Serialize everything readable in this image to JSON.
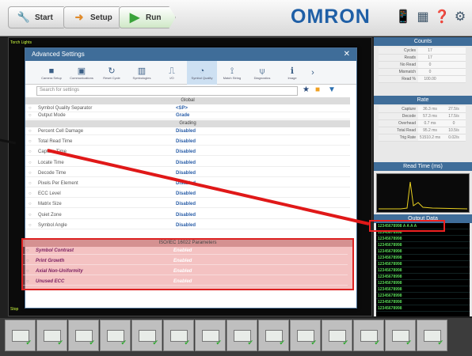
{
  "steps": {
    "start": "Start",
    "setup": "Setup",
    "run": "Run"
  },
  "brand": "OMRON",
  "cam_label_top": "Torch Lights",
  "cam_label_bottom": "Stop",
  "dialog": {
    "title": "Advanced Settings",
    "toolbar": [
      {
        "label": "Camera Setup",
        "icon": "camera-icon"
      },
      {
        "label": "Communications",
        "icon": "display-icon"
      },
      {
        "label": "Reset Cycle",
        "icon": "reset-icon"
      },
      {
        "label": "Symbologies",
        "icon": "barcode-icon"
      },
      {
        "label": "I/O",
        "icon": "pulse-icon"
      },
      {
        "label": "Symbol Quality",
        "icon": "quality-icon"
      },
      {
        "label": "Match String",
        "icon": "match-icon"
      },
      {
        "label": "Diagnostics",
        "icon": "diagnostics-icon"
      },
      {
        "label": "Image",
        "icon": "image-icon"
      }
    ],
    "search_placeholder": "Search for settings",
    "group_global": "Global",
    "global_rows": [
      {
        "name": "Symbol Quality Separator",
        "value": "<SP>"
      },
      {
        "name": "Output Mode",
        "value": "Grade"
      }
    ],
    "group_grading": "Grading",
    "grading_rows": [
      {
        "name": "Percent Cell Damage",
        "value": "Disabled"
      },
      {
        "name": "Total Read Time",
        "value": "Disabled"
      },
      {
        "name": "Capture Time",
        "value": "Disabled"
      },
      {
        "name": "Locate Time",
        "value": "Disabled"
      },
      {
        "name": "Decode Time",
        "value": "Disabled"
      },
      {
        "name": "Pixels Per Element",
        "value": "Disabled"
      },
      {
        "name": "ECC Level",
        "value": "Disabled"
      },
      {
        "name": "Matrix Size",
        "value": "Disabled"
      },
      {
        "name": "Quiet Zone",
        "value": "Disabled"
      },
      {
        "name": "Symbol Angle",
        "value": "Disabled"
      }
    ],
    "group_iso": "ISO/IEC 16022 Parameters",
    "iso_rows": [
      {
        "name": "Symbol Contrast",
        "value": "Enabled"
      },
      {
        "name": "Print Growth",
        "value": "Enabled"
      },
      {
        "name": "Axial Non-Uniformity",
        "value": "Enabled"
      },
      {
        "name": "Unused ECC",
        "value": "Enabled"
      }
    ]
  },
  "counts": {
    "title": "Counts",
    "rows": [
      {
        "k": "Cycles",
        "v": "17"
      },
      {
        "k": "Reads",
        "v": "17"
      },
      {
        "k": "No Read",
        "v": "0"
      },
      {
        "k": "Mismatch",
        "v": "0"
      },
      {
        "k": "Read %",
        "v": "100.00"
      }
    ]
  },
  "rate": {
    "title": "Rate",
    "rows": [
      {
        "k": "Capture",
        "v": "36.3 ms",
        "v2": "27.5/s"
      },
      {
        "k": "Decode",
        "v": "57.3 ms",
        "v2": "17.5/s"
      },
      {
        "k": "Overhead",
        "v": "0.7 ms",
        "v2": "0"
      },
      {
        "k": "Total Read",
        "v": "95.2 ms",
        "v2": "10.5/s"
      },
      {
        "k": "Trig Rate",
        "v": "51510.2 ms",
        "v2": "0.02/s"
      }
    ]
  },
  "read_time_title": "Read Time (ms)",
  "output": {
    "title": "Output Data",
    "rows": [
      "12345678998 A A A A",
      "12345678998",
      "12345678998",
      "12345678998",
      "12345678998",
      "12345678998",
      "12345678998",
      "12345678998",
      "12345678998",
      "12345678998",
      "12345678998",
      "12345678998",
      "12345678998",
      "12345678998"
    ]
  },
  "thumb_count": 14,
  "colors": {
    "accent": "#3f6d99",
    "brand": "#1f5fa6",
    "highlight": "#dd2222",
    "output_text": "#58d858"
  }
}
